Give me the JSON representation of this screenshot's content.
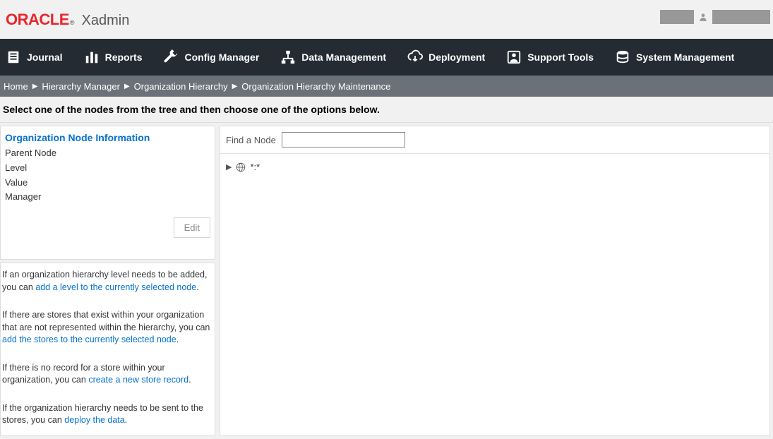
{
  "header": {
    "logo_text": "ORACLE",
    "logo_reg": "®",
    "app_name": "Xadmin"
  },
  "nav": {
    "items": [
      {
        "label": "Journal"
      },
      {
        "label": "Reports"
      },
      {
        "label": "Config Manager"
      },
      {
        "label": "Data Management"
      },
      {
        "label": "Deployment"
      },
      {
        "label": "Support Tools"
      },
      {
        "label": "System Management"
      }
    ]
  },
  "breadcrumb": {
    "items": [
      "Home",
      "Hierarchy Manager",
      "Organization Hierarchy",
      "Organization Hierarchy Maintenance"
    ]
  },
  "instruction": "Select one of the nodes from the tree and then choose one of the options below.",
  "info_panel": {
    "title": "Organization Node Information",
    "rows": [
      "Parent Node",
      "Level",
      "Value",
      "Manager"
    ],
    "edit_label": "Edit"
  },
  "help": {
    "paras": [
      {
        "pre": "If an organization hierarchy level needs to be added, you can ",
        "link": "add a level to the currently selected node",
        "post": "."
      },
      {
        "pre": "If there are stores that exist within your organization that are not represented within the hierarchy, you can ",
        "link": "add the stores to the currently selected node",
        "post": "."
      },
      {
        "pre": "If there is no record for a store within your organization, you can ",
        "link": "create a new store record",
        "post": "."
      },
      {
        "pre": "If the organization hierarchy needs to be sent to the stores, you can ",
        "link": "deploy the data",
        "post": "."
      }
    ]
  },
  "main": {
    "find_label": "Find a Node",
    "find_value": "",
    "tree_root": "*:*"
  }
}
